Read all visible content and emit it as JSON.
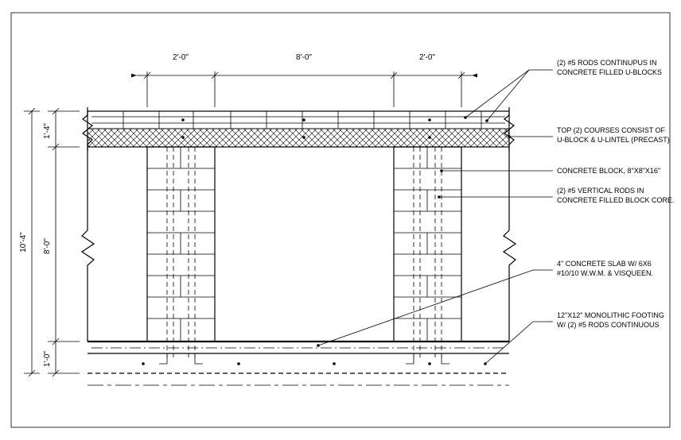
{
  "dims_top": {
    "left_pier": "2'-0\"",
    "opening": "8'-0\"",
    "right_pier": "2'-0\""
  },
  "dims_left": {
    "top_band": "1'-4\"",
    "wall": "8'-0\"",
    "footing": "1'-0\"",
    "overall": "10'-4\""
  },
  "notes": {
    "n1": "(2) #5 RODS CONTINUPUS IN CONCRETE FILLED U-BLOCKS",
    "n2": "TOP (2) COURSES CONSIST OF U-BLOCK & U-LINTEL (PRECAST)",
    "n3": "CONCRETE BLOCK, 8\"X8\"X16\"",
    "n4": "(2) #5 VERTICAL RODS IN CONCRETE FILLED BLOCK CORE.",
    "n5": "4\" CONCRETE SLAB W/ 6X6 #10/10 W.W.M. & VISQUEEN.",
    "n6": "12\"X12\" MONOLITHIC FOOTING W/ (2) #5 RODS CONTINUOUS"
  }
}
